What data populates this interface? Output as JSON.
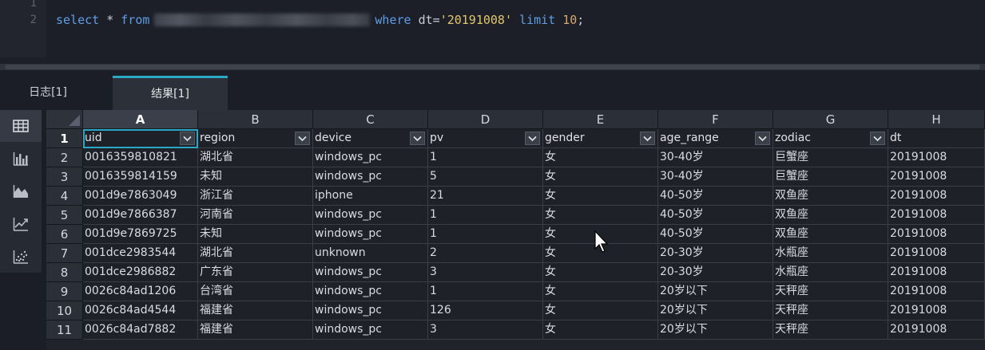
{
  "editor": {
    "line_numbers": [
      "1",
      "2"
    ],
    "sql": {
      "kw_select": "select",
      "star": " * ",
      "kw_from": "from",
      "kw_where": "where",
      "field": " dt=",
      "value": "'20191008'",
      "kw_limit": " limit ",
      "limit_num": "10",
      "end": ";"
    }
  },
  "tabs": {
    "log": "日志[1]",
    "result": "结果[1]"
  },
  "sidebar": {
    "icons": [
      "table-icon",
      "bar-chart-icon",
      "area-chart-icon",
      "line-chart-icon",
      "scatter-chart-icon"
    ]
  },
  "grid": {
    "column_letters": [
      "A",
      "B",
      "C",
      "D",
      "E",
      "F",
      "G",
      "H"
    ],
    "row_numbers": [
      "1",
      "2",
      "3",
      "4",
      "5",
      "6",
      "7",
      "8",
      "9",
      "10",
      "11"
    ],
    "headers": [
      "uid",
      "region",
      "device",
      "pv",
      "gender",
      "age_range",
      "zodiac",
      "dt"
    ],
    "rows": [
      [
        "0016359810821",
        "湖北省",
        "windows_pc",
        "1",
        "女",
        "30-40岁",
        "巨蟹座",
        "20191008"
      ],
      [
        "0016359814159",
        "未知",
        "windows_pc",
        "5",
        "女",
        "30-40岁",
        "巨蟹座",
        "20191008"
      ],
      [
        "001d9e7863049",
        "浙江省",
        "iphone",
        "21",
        "女",
        "40-50岁",
        "双鱼座",
        "20191008"
      ],
      [
        "001d9e7866387",
        "河南省",
        "windows_pc",
        "1",
        "女",
        "40-50岁",
        "双鱼座",
        "20191008"
      ],
      [
        "001d9e7869725",
        "未知",
        "windows_pc",
        "1",
        "女",
        "40-50岁",
        "双鱼座",
        "20191008"
      ],
      [
        "001dce2983544",
        "湖北省",
        "unknown",
        "2",
        "女",
        "20-30岁",
        "水瓶座",
        "20191008"
      ],
      [
        "001dce2986882",
        "广东省",
        "windows_pc",
        "3",
        "女",
        "20-30岁",
        "水瓶座",
        "20191008"
      ],
      [
        "0026c84ad1206",
        "台湾省",
        "windows_pc",
        "1",
        "女",
        "20岁以下",
        "天秤座",
        "20191008"
      ],
      [
        "0026c84ad4544",
        "福建省",
        "windows_pc",
        "126",
        "女",
        "20岁以下",
        "天秤座",
        "20191008"
      ],
      [
        "0026c84ad7882",
        "福建省",
        "windows_pc",
        "3",
        "女",
        "20岁以下",
        "天秤座",
        "20191008"
      ]
    ]
  },
  "colors": {
    "accent": "#2aa9c6",
    "keyword": "#5e9ee6",
    "string": "#e2c66b"
  }
}
